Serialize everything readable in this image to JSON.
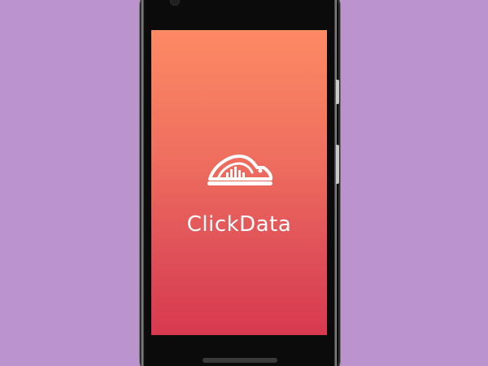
{
  "app": {
    "name": "ClickData",
    "logo_icon": "clickdata-mouse-chart-logo"
  },
  "device": {
    "type": "android-phone",
    "frame_color": "#0b0b0b"
  },
  "splash": {
    "gradient_top": "#fc8a64",
    "gradient_bottom": "#d8394f"
  },
  "background_color": "#bb93cd"
}
